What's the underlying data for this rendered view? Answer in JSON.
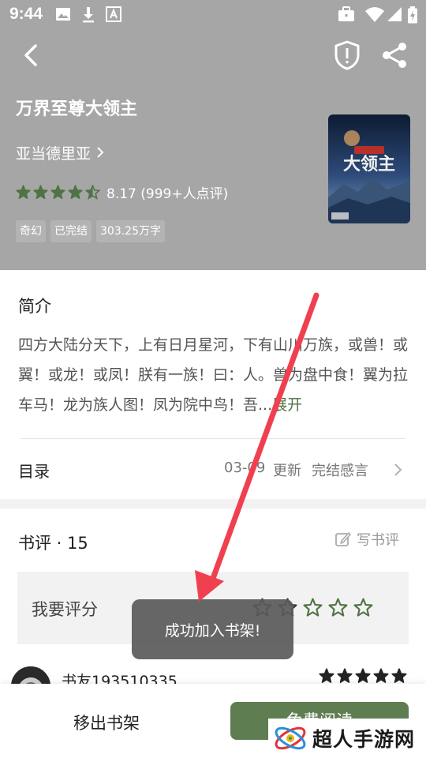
{
  "status_bar": {
    "time": "9:44",
    "left_icons": [
      "image-icon",
      "download-icon",
      "text-icon"
    ],
    "right_icons": [
      "briefcase-icon",
      "wifi-icon",
      "signal-icon",
      "battery-icon"
    ]
  },
  "header": {
    "back_icon": "chevron-left-icon",
    "report_icon": "shield-alert-icon",
    "share_icon": "share-icon"
  },
  "book": {
    "title": "万界至尊大领主",
    "author": "亚当德里亚",
    "rating": 4.5,
    "rating_text": "8.17 (999+人点评)",
    "tags": [
      "奇幻",
      "已完结",
      "303.25万字"
    ],
    "cover_text": "大领主"
  },
  "intro": {
    "heading": "简介",
    "text": "四方大陆分天下，上有日月星河，下有山川万族，或兽！或翼！或龙！或凤！朕有一族！曰：人。兽为盘中食！翼为拉车马！龙为族人图！凤为院中鸟！吾...",
    "expand_label": "展开"
  },
  "toc": {
    "label": "目录",
    "date": "03-09",
    "update_label": "更新",
    "latest_chapter": "完结感言"
  },
  "reviews": {
    "title": "书评 · 15",
    "write_label": "写书评",
    "rate_label": "我要评分",
    "rate_star_count": 5,
    "items": [
      {
        "name": "书友193510335",
        "stars": 5
      }
    ]
  },
  "bottom_bar": {
    "remove_label": "移出书架",
    "read_label": "免费阅读"
  },
  "toast": {
    "text": "成功加入书架!"
  },
  "watermark": {
    "text": "超人手游网"
  },
  "colors": {
    "header_bg": "#a6a6a6",
    "accent_green": "#5e7e52",
    "star_green": "#4f7344",
    "annotation_red": "#f0404f"
  }
}
